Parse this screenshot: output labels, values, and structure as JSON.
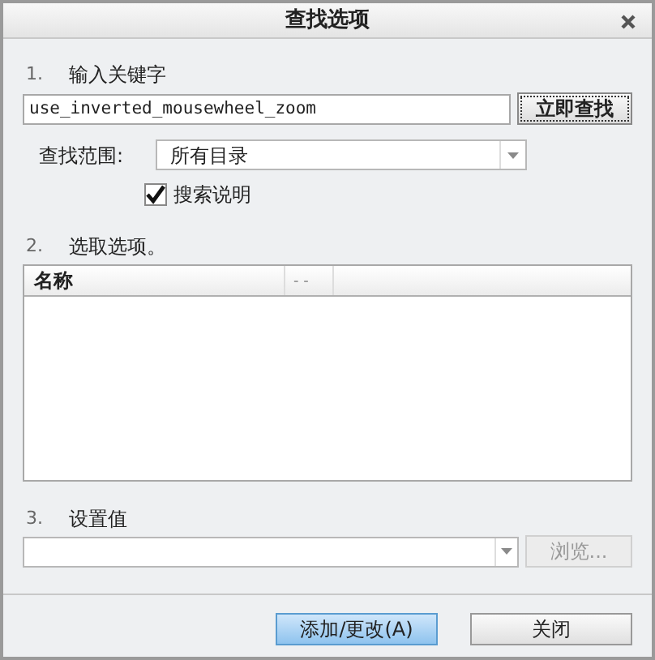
{
  "window": {
    "title": "查找选项"
  },
  "step1": {
    "number": "1.",
    "label": "输入关键字",
    "keyword": {
      "value": "use_inverted_mousewheel_zoom"
    },
    "search_button": "立即查找",
    "scope": {
      "label": "查找范围:",
      "value": "所有目录"
    },
    "search_description": {
      "label": "搜索说明",
      "checked": true
    }
  },
  "step2": {
    "number": "2.",
    "label": "选取选项。",
    "table": {
      "columns": [
        "名称",
        "- -"
      ]
    }
  },
  "step3": {
    "number": "3.",
    "label": "设置值",
    "browse": {
      "label": "浏览...",
      "disabled": true
    }
  },
  "buttons": [
    {
      "label": "添加/更改(A)",
      "default": true
    },
    {
      "label": "关闭",
      "default": false
    }
  ]
}
